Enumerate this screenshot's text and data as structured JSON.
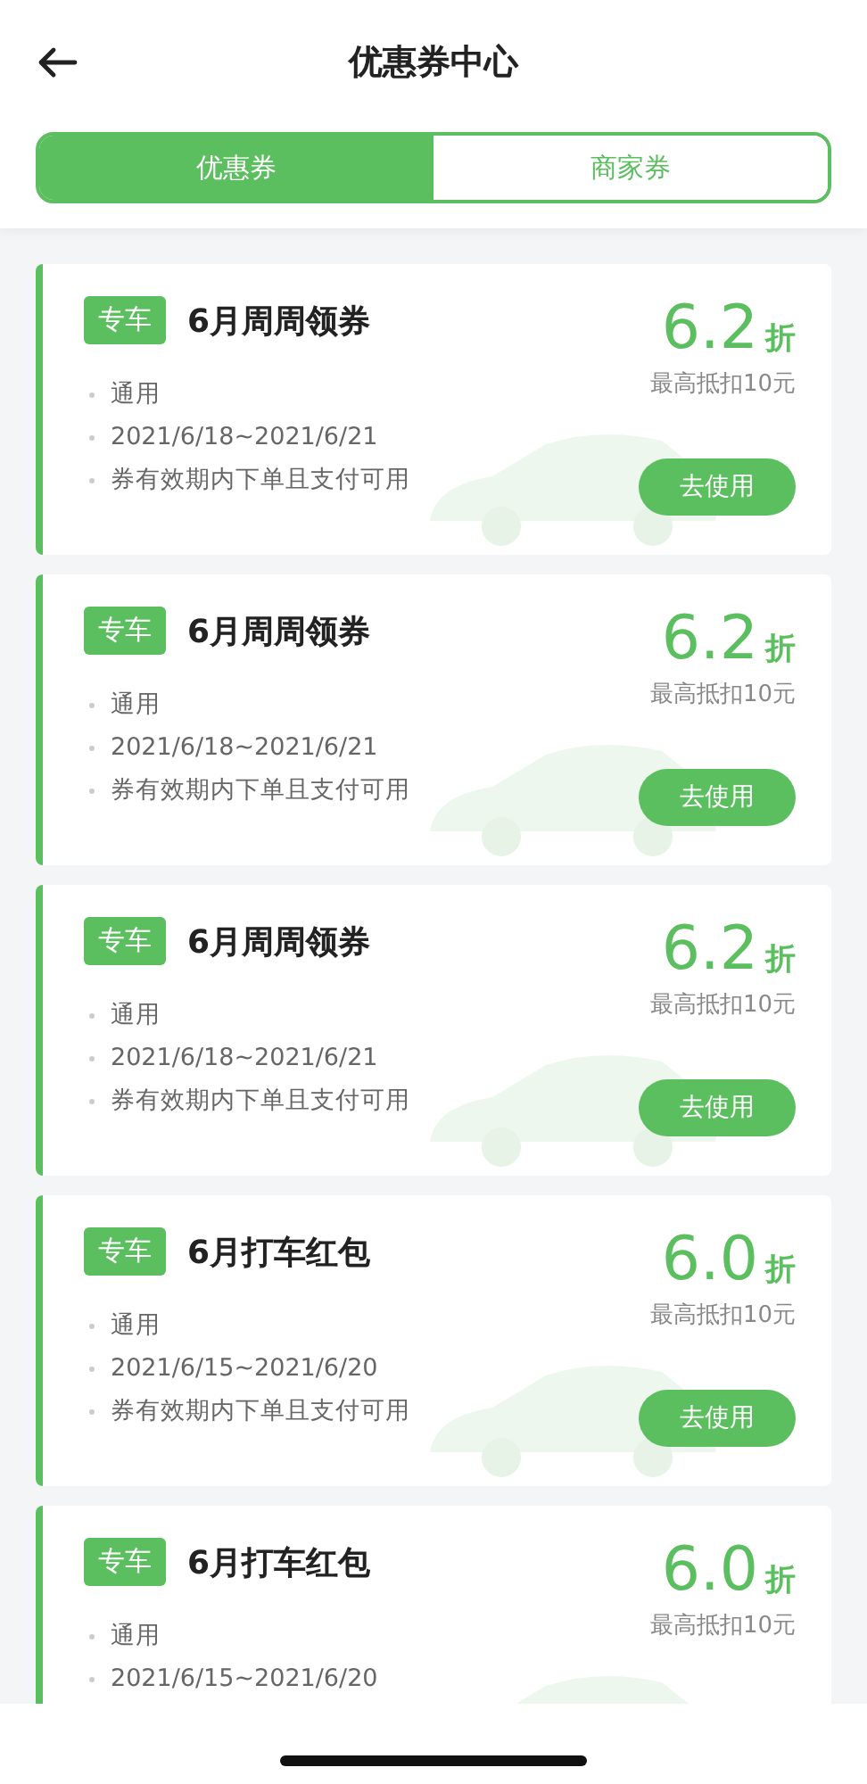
{
  "header": {
    "title": "优惠券中心"
  },
  "tabs": [
    {
      "label": "优惠券",
      "selected": true
    },
    {
      "label": "商家券",
      "selected": false
    }
  ],
  "coupons": [
    {
      "tag": "专车",
      "title": "6月周周领券",
      "discount": "6.2",
      "unit": "折",
      "cap": "最高抵扣10元",
      "details": [
        "通用",
        "2021/6/18~2021/6/21",
        "券有效期内下单且支付可用"
      ],
      "button": "去使用"
    },
    {
      "tag": "专车",
      "title": "6月周周领券",
      "discount": "6.2",
      "unit": "折",
      "cap": "最高抵扣10元",
      "details": [
        "通用",
        "2021/6/18~2021/6/21",
        "券有效期内下单且支付可用"
      ],
      "button": "去使用"
    },
    {
      "tag": "专车",
      "title": "6月周周领券",
      "discount": "6.2",
      "unit": "折",
      "cap": "最高抵扣10元",
      "details": [
        "通用",
        "2021/6/18~2021/6/21",
        "券有效期内下单且支付可用"
      ],
      "button": "去使用"
    },
    {
      "tag": "专车",
      "title": "6月打车红包",
      "discount": "6.0",
      "unit": "折",
      "cap": "最高抵扣10元",
      "details": [
        "通用",
        "2021/6/15~2021/6/20",
        "券有效期内下单且支付可用"
      ],
      "button": "去使用"
    },
    {
      "tag": "专车",
      "title": "6月打车红包",
      "discount": "6.0",
      "unit": "折",
      "cap": "最高抵扣10元",
      "details": [
        "通用",
        "2021/6/15~2021/6/20"
      ]
    }
  ]
}
